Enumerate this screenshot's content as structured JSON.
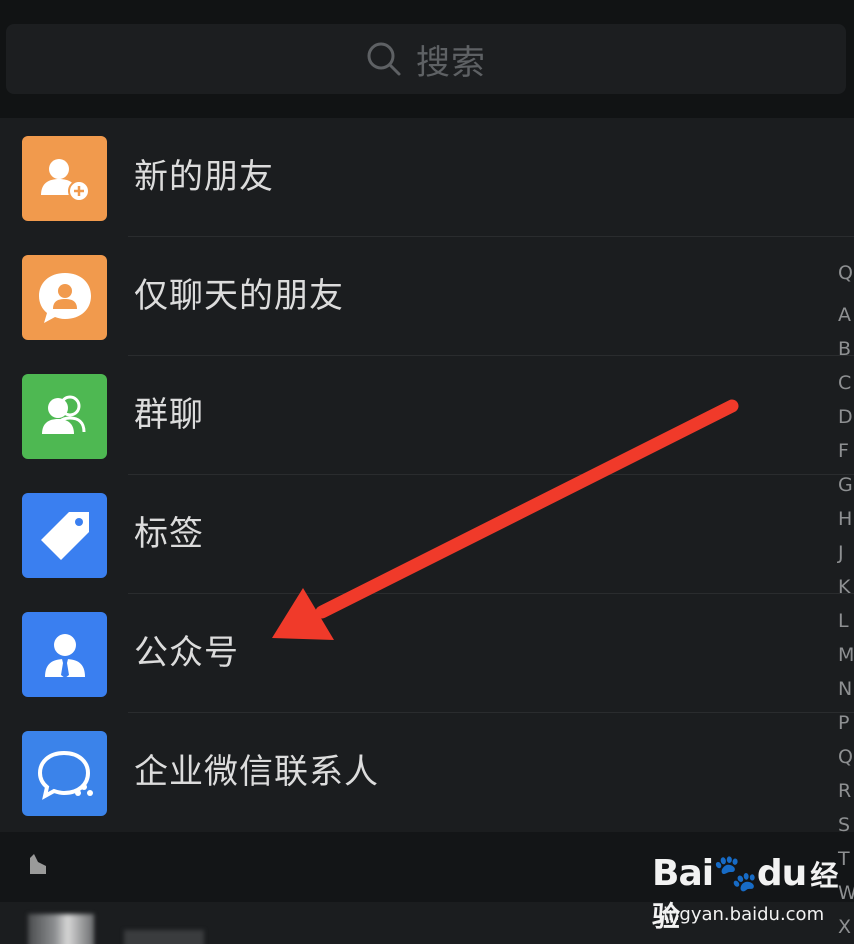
{
  "search": {
    "placeholder": "搜索",
    "icon": "search-icon"
  },
  "menu": [
    {
      "label": "新的朋友",
      "icon": "add-friend-icon",
      "color": "#f19a4d"
    },
    {
      "label": "仅聊天的朋友",
      "icon": "chat-only-friend-icon",
      "color": "#f19a4d"
    },
    {
      "label": "群聊",
      "icon": "group-chat-icon",
      "color": "#4eb852"
    },
    {
      "label": "标签",
      "icon": "tag-icon",
      "color": "#3a7ff0"
    },
    {
      "label": "公众号",
      "icon": "official-account-icon",
      "color": "#3a7ff0"
    },
    {
      "label": "企业微信联系人",
      "icon": "work-contacts-icon",
      "color": "#3b83ea"
    }
  ],
  "index_letters": [
    "Q",
    "A",
    "B",
    "C",
    "D",
    "F",
    "G",
    "H",
    "J",
    "K",
    "L",
    "M",
    "N",
    "P",
    "Q",
    "R",
    "S",
    "T",
    "W",
    "X"
  ],
  "annotation": {
    "color": "#f03a2a"
  },
  "watermark": {
    "brand": "Bai",
    "brand2": "du",
    "brand3": "经验",
    "url": "jingyan.baidu.com"
  }
}
